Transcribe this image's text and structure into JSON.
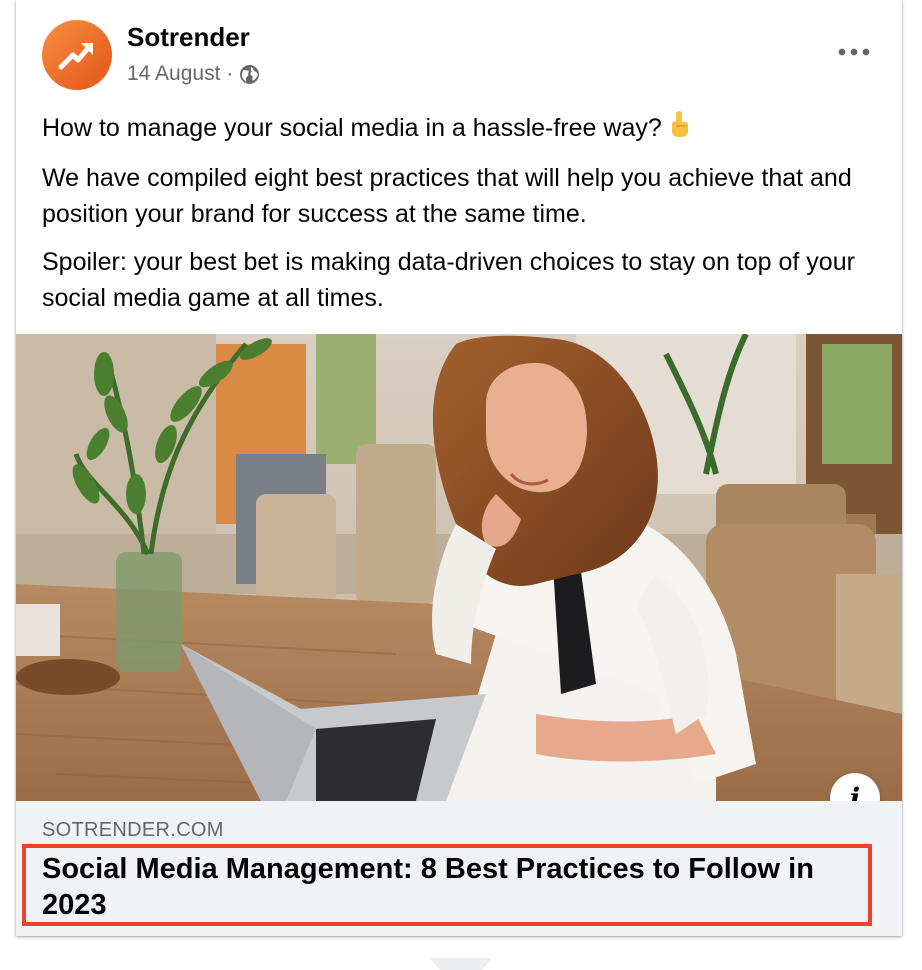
{
  "post": {
    "author": "Sotrender",
    "date": "14 August",
    "separator": "·",
    "audience_icon": "globe-icon",
    "menu_icon": "more-horizontal-icon",
    "paragraphs": {
      "p1": "How to manage your social media in a hassle-free way?",
      "p1_emoji": "pointing-up-hand-emoji",
      "p2": "We have compiled eight best practices that will help you achieve that and position your brand for success at the same time.",
      "p3": "Spoiler: your best bet is making data-driven choices to stay on top of your social media game at all times."
    }
  },
  "link_preview": {
    "domain": "SOTRENDER.COM",
    "title": "Social Media Management: 8 Best Practices to Follow in 2023",
    "info_button": "i"
  },
  "colors": {
    "brand_orange": "#ef7a33",
    "highlight_red": "#e8432d",
    "footer_bg": "#f0f2f5",
    "meta_gray": "#65676b"
  }
}
